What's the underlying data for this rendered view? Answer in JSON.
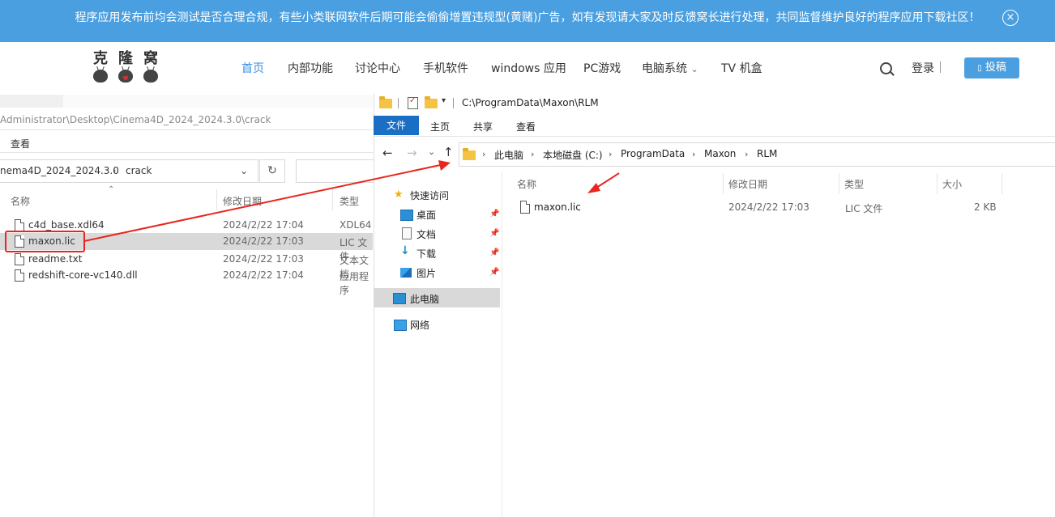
{
  "banner": {
    "text": "程序应用发布前均会测试是否合理合规，有些小类联网软件后期可能会偷偷增置违规型(黄赌)广告，如有发现请大家及时反馈窝长进行处理，共同监督维护良好的程序应用下载社区！",
    "close_glyph": "×"
  },
  "logo": {
    "chars": [
      "克",
      "隆",
      "窝"
    ]
  },
  "nav": {
    "items": [
      "首页",
      "内部功能",
      "讨论中心",
      "手机软件",
      "windows 应用",
      "PC游戏",
      "电脑系统",
      "TV 机盒"
    ],
    "dropdown_glyph": "⌄",
    "login": "登录",
    "submit": "投稿",
    "submit_glyph": "▯"
  },
  "left_explorer": {
    "path_text": "Administrator\\Desktop\\Cinema4D_2024_2024.3.0\\crack",
    "ribbon_view": "查看",
    "breadcrumb": [
      "nema4D_2024_2024.3.0",
      "crack"
    ],
    "columns": [
      "名称",
      "修改日期",
      "类型"
    ],
    "files": [
      {
        "name": "c4d_base.xdl64",
        "date": "2024/2/22 17:04",
        "type": "XDL64"
      },
      {
        "name": "maxon.lic",
        "date": "2024/2/22 17:03",
        "type": "LIC 文件"
      },
      {
        "name": "readme.txt",
        "date": "2024/2/22 17:03",
        "type": "文本文档"
      },
      {
        "name": "redshift-core-vc140.dll",
        "date": "2024/2/22 17:04",
        "type": "应用程序"
      }
    ]
  },
  "right_explorer": {
    "title_path": "C:\\ProgramData\\Maxon\\RLM",
    "ribbon_tabs": [
      "文件",
      "主页",
      "共享",
      "查看"
    ],
    "breadcrumb": [
      "此电脑",
      "本地磁盘 (C:)",
      "ProgramData",
      "Maxon",
      "RLM"
    ],
    "nav_glyphs": {
      "back": "←",
      "forward": "→",
      "recent": "⌄",
      "up": "↑",
      "sep": "›"
    },
    "sidebar": [
      {
        "label": "快速访问",
        "icon": "star-icon",
        "pinned": false
      },
      {
        "label": "桌面",
        "icon": "desktop-icon",
        "pinned": true
      },
      {
        "label": "文档",
        "icon": "document-icon",
        "pinned": true
      },
      {
        "label": "下载",
        "icon": "download-icon",
        "pinned": true
      },
      {
        "label": "图片",
        "icon": "pictures-icon",
        "pinned": true
      },
      {
        "label": "此电脑",
        "icon": "computer-icon",
        "pinned": false
      },
      {
        "label": "网络",
        "icon": "network-icon",
        "pinned": false
      }
    ],
    "columns": [
      "名称",
      "修改日期",
      "类型",
      "大小"
    ],
    "files": [
      {
        "name": "maxon.lic",
        "date": "2024/2/22 17:03",
        "type": "LIC 文件",
        "size": "2 KB"
      }
    ]
  },
  "colors": {
    "accent": "#4a9fe0",
    "ribbon_file": "#1a6fc4",
    "annotation": "#e8261f",
    "selected_row": "#d9d9d9"
  }
}
